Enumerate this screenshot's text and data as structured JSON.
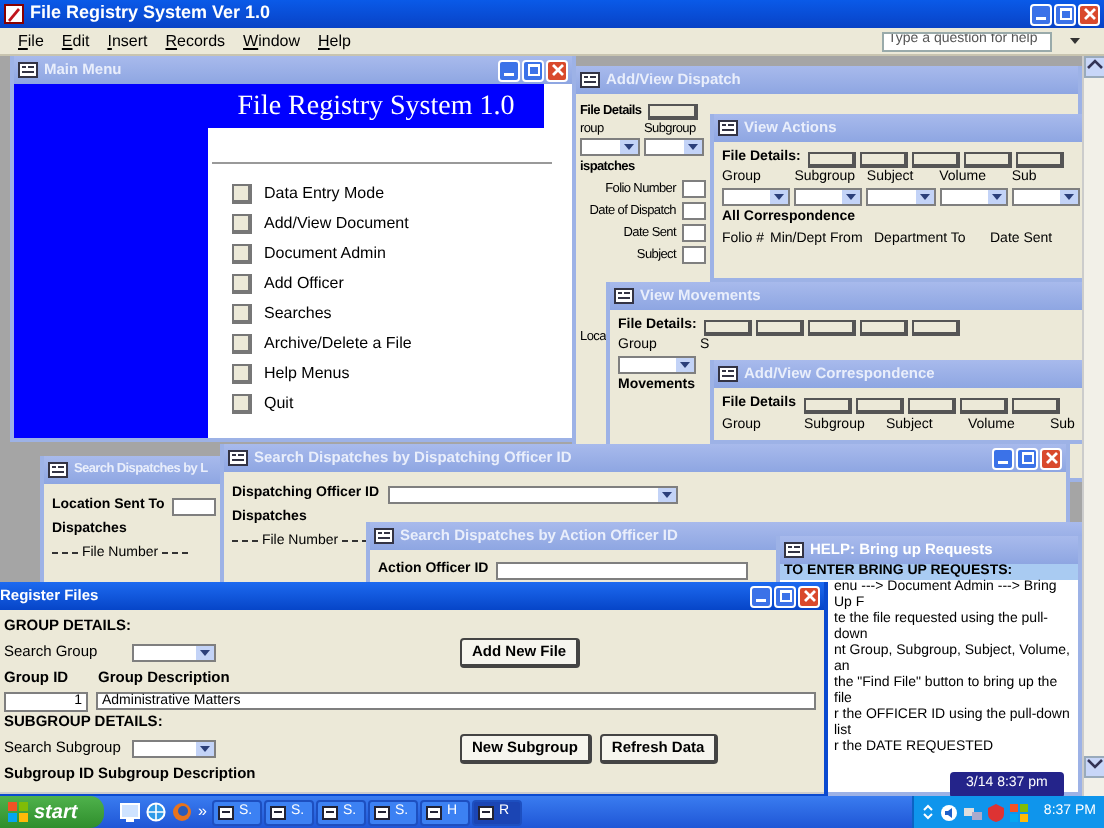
{
  "app": {
    "title": "File Registry System Ver 1.0",
    "menu": [
      "File",
      "Edit",
      "Insert",
      "Records",
      "Window",
      "Help"
    ],
    "help_placeholder": "Type a question for help"
  },
  "windows": [
    {
      "kind": "form",
      "title": "Add/View Dispatch",
      "active": false,
      "rows": [
        [
          {
            "kind": "heading",
            "text": "File Details"
          },
          {
            "kind": "boxes"
          }
        ],
        [
          {
            "kind": "columns",
            "labels": [
              "roup",
              "Subgroup"
            ]
          }
        ],
        [
          {
            "kind": "heading",
            "text": "ispatches"
          }
        ],
        [
          {
            "kind": "pair",
            "label": "Folio Number"
          }
        ],
        [
          {
            "kind": "pair",
            "label": "Date of Dispatch"
          }
        ],
        [
          {
            "kind": "pair",
            "label": "Date Sent"
          }
        ],
        [
          {
            "kind": "pair",
            "label": "Subject"
          }
        ],
        [
          {
            "kind": "label",
            "text": "Loca"
          }
        ]
      ]
    },
    {
      "kind": "form",
      "title": "View Actions",
      "active": false,
      "rows": [
        [
          {
            "kind": "heading",
            "text": "File Details:"
          },
          {
            "kind": "boxes"
          }
        ],
        [
          {
            "kind": "columns",
            "labels": [
              "Group",
              "Subgroup",
              "Subject",
              "Volume",
              "Sub"
            ]
          }
        ],
        [
          {
            "kind": "heading",
            "text": "All Correspondence"
          }
        ],
        [
          {
            "kind": "headers",
            "labels": [
              "Folio #",
              "Min/Dept From",
              "Department To",
              "Date Sent"
            ]
          }
        ]
      ]
    },
    {
      "kind": "form",
      "title": "View Movements",
      "active": false,
      "rows": [
        [
          {
            "kind": "heading",
            "text": "File Details:"
          },
          {
            "kind": "boxes"
          }
        ],
        [
          {
            "kind": "columns",
            "labels": [
              "Group",
              "S"
            ]
          }
        ],
        [
          {
            "kind": "heading",
            "text": "Movements"
          }
        ]
      ]
    },
    {
      "kind": "form",
      "title": "Add/View Correspondence",
      "active": false,
      "rows": [
        [
          {
            "kind": "heading",
            "text": "File Details"
          },
          {
            "kind": "boxes"
          }
        ],
        [
          {
            "kind": "headers",
            "labels": [
              "Group",
              "Subgroup",
              "Subject",
              "Volume",
              "Sub"
            ]
          }
        ]
      ]
    },
    {
      "kind": "menu",
      "title": "Main Menu",
      "active": false,
      "controls": true,
      "banner": "File Registry System 1.0",
      "items": [
        "Data Entry Mode",
        "Add/View Document",
        "Document Admin",
        "Add Officer",
        "Searches",
        "Archive/Delete a File",
        "Help Menus",
        "Quit"
      ]
    },
    {
      "kind": "form",
      "title": "Search Dispatches by L",
      "active": false,
      "rows": [
        [
          {
            "kind": "heading",
            "text": "Location Sent To"
          },
          {
            "kind": "field"
          }
        ],
        [
          {
            "kind": "heading",
            "text": "Dispatches"
          }
        ],
        [
          {
            "kind": "rule",
            "text": "File Number"
          }
        ]
      ]
    },
    {
      "kind": "form",
      "title": "Search Dispatches by Dispatching Officer ID",
      "active": false,
      "controls": true,
      "rows": [
        [
          {
            "kind": "heading",
            "text": "Dispatching Officer ID"
          },
          {
            "kind": "combo"
          }
        ],
        [
          {
            "kind": "heading",
            "text": "Dispatches"
          }
        ],
        [
          {
            "kind": "rule",
            "text": "File Number"
          }
        ]
      ]
    },
    {
      "kind": "form",
      "title": "Search Dispatches by Action Officer ID",
      "active": false,
      "rows": [
        [
          {
            "kind": "heading",
            "text": "Action Officer ID"
          },
          {
            "kind": "field"
          }
        ]
      ]
    },
    {
      "kind": "help",
      "title": "HELP: Bring up Requests",
      "active": false,
      "heading": "TO ENTER BRING UP REQUESTS:",
      "lines": [
        "enu ---> Document Admin ---> Bring Up F",
        "te the file requested using the pull-down",
        "nt Group, Subgroup, Subject, Volume, an",
        "the \"Find File\" button to bring up the file",
        "r the OFFICER ID using the pull-down list",
        "r the DATE REQUESTED"
      ]
    },
    {
      "kind": "form",
      "title": "Register Files",
      "active": true,
      "controls": true,
      "scrollbar": true,
      "rows": [
        [
          {
            "kind": "heading",
            "text": "GROUP DETAILS:"
          }
        ],
        [
          {
            "kind": "label",
            "text": "Search Group"
          },
          {
            "kind": "picker"
          },
          {
            "kind": "button",
            "label": "Add New File"
          }
        ],
        [
          {
            "kind": "headers",
            "labels": [
              "Group ID",
              "Group Description"
            ]
          }
        ],
        [
          {
            "kind": "idfield",
            "value": "1"
          },
          {
            "kind": "field",
            "value": "Administrative Matters"
          }
        ],
        [
          {
            "kind": "heading",
            "text": "SUBGROUP DETAILS:"
          }
        ],
        [
          {
            "kind": "label",
            "text": "Search Subgroup"
          },
          {
            "kind": "picker"
          },
          {
            "kind": "button",
            "label": "New Subgroup"
          },
          {
            "kind": "button",
            "label": "Refresh Data"
          }
        ],
        [
          {
            "kind": "headers",
            "labels": [
              "Subgroup ID",
              "Subgroup Description"
            ]
          }
        ]
      ]
    }
  ],
  "tooltip": "3/14 8:37 pm",
  "taskbar": {
    "start": "start",
    "overflow": "»",
    "tasks": [
      {
        "label": "S.",
        "selected": false
      },
      {
        "label": "S.",
        "selected": false
      },
      {
        "label": "S.",
        "selected": false
      },
      {
        "label": "S.",
        "selected": false
      },
      {
        "label": "H",
        "selected": false
      },
      {
        "label": "R",
        "selected": true
      }
    ],
    "clock": "8:37 PM"
  }
}
